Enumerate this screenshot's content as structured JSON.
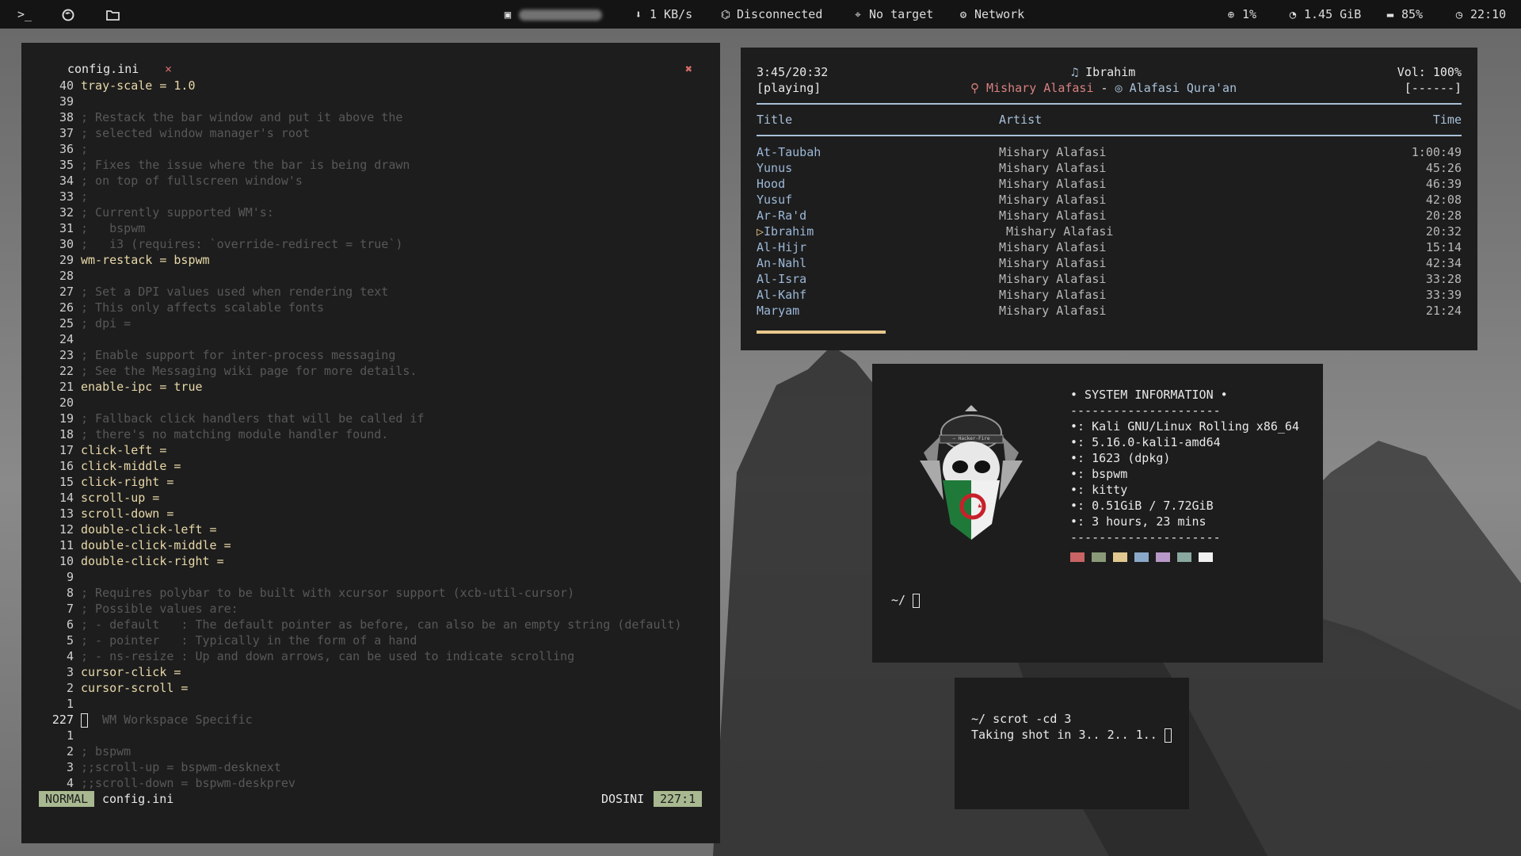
{
  "topbar": {
    "terminal_icon": "terminal-icon",
    "net_speed": "1 KB/s",
    "vpn": "Disconnected",
    "target": "No target",
    "network": "Network",
    "cpu": "1%",
    "ram": "1.45 GiB",
    "disk": "85%",
    "clock": "22:10"
  },
  "editor": {
    "tab_label": "config.ini",
    "tab_close": "×",
    "window_close": "✖",
    "lines": [
      {
        "n": "40",
        "text": "tray-scale = 1.0",
        "kind": "kw"
      },
      {
        "n": "39",
        "text": "",
        "kind": "cm"
      },
      {
        "n": "38",
        "text": "; Restack the bar window and put it above the",
        "kind": "cm"
      },
      {
        "n": "37",
        "text": "; selected window manager's root",
        "kind": "cm"
      },
      {
        "n": "36",
        "text": ";",
        "kind": "cm"
      },
      {
        "n": "35",
        "text": "; Fixes the issue where the bar is being drawn",
        "kind": "cm"
      },
      {
        "n": "34",
        "text": "; on top of fullscreen window's",
        "kind": "cm"
      },
      {
        "n": "33",
        "text": ";",
        "kind": "cm"
      },
      {
        "n": "32",
        "text": "; Currently supported WM's:",
        "kind": "cm"
      },
      {
        "n": "31",
        "text": ";   bspwm",
        "kind": "cm"
      },
      {
        "n": "30",
        "text": ";   i3 (requires: `override-redirect = true`)",
        "kind": "cm"
      },
      {
        "n": "29",
        "text": "wm-restack = bspwm",
        "kind": "kw"
      },
      {
        "n": "28",
        "text": "",
        "kind": "cm"
      },
      {
        "n": "27",
        "text": "; Set a DPI values used when rendering text",
        "kind": "cm"
      },
      {
        "n": "26",
        "text": "; This only affects scalable fonts",
        "kind": "cm"
      },
      {
        "n": "25",
        "text": "; dpi =",
        "kind": "cm"
      },
      {
        "n": "24",
        "text": "",
        "kind": "cm"
      },
      {
        "n": "23",
        "text": "; Enable support for inter-process messaging",
        "kind": "cm"
      },
      {
        "n": "22",
        "text": "; See the Messaging wiki page for more details.",
        "kind": "cm"
      },
      {
        "n": "21",
        "text": "enable-ipc = true",
        "kind": "kw"
      },
      {
        "n": "20",
        "text": "",
        "kind": "cm"
      },
      {
        "n": "19",
        "text": "; Fallback click handlers that will be called if",
        "kind": "cm"
      },
      {
        "n": "18",
        "text": "; there's no matching module handler found.",
        "kind": "cm"
      },
      {
        "n": "17",
        "text": "click-left =",
        "kind": "kw"
      },
      {
        "n": "16",
        "text": "click-middle =",
        "kind": "kw"
      },
      {
        "n": "15",
        "text": "click-right =",
        "kind": "kw"
      },
      {
        "n": "14",
        "text": "scroll-up =",
        "kind": "kw"
      },
      {
        "n": "13",
        "text": "scroll-down =",
        "kind": "kw"
      },
      {
        "n": "12",
        "text": "double-click-left =",
        "kind": "kw"
      },
      {
        "n": "11",
        "text": "double-click-middle =",
        "kind": "kw"
      },
      {
        "n": "10",
        "text": "double-click-right =",
        "kind": "kw"
      },
      {
        "n": "9",
        "text": "",
        "kind": "cm"
      },
      {
        "n": "8",
        "text": "; Requires polybar to be built with xcursor support (xcb-util-cursor)",
        "kind": "cm"
      },
      {
        "n": "7",
        "text": "; Possible values are:",
        "kind": "cm"
      },
      {
        "n": "6",
        "text": "; - default   : The default pointer as before, can also be an empty string (default)",
        "kind": "cm"
      },
      {
        "n": "5",
        "text": "; - pointer   : Typically in the form of a hand",
        "kind": "cm"
      },
      {
        "n": "4",
        "text": "; - ns-resize : Up and down arrows, can be used to indicate scrolling",
        "kind": "cm"
      },
      {
        "n": "3",
        "text": "cursor-click =",
        "kind": "kw"
      },
      {
        "n": "2",
        "text": "cursor-scroll =",
        "kind": "kw"
      },
      {
        "n": "1",
        "text": "",
        "kind": "cm"
      },
      {
        "n": "227",
        "text": "  WM Workspace Specific",
        "kind": "cur"
      },
      {
        "n": "1",
        "text": "",
        "kind": "cm"
      },
      {
        "n": "2",
        "text": "; bspwm",
        "kind": "cm"
      },
      {
        "n": "3",
        "text": ";;scroll-up = bspwm-desknext",
        "kind": "cm"
      },
      {
        "n": "4",
        "text": ";;scroll-down = bspwm-deskprev",
        "kind": "cm"
      }
    ],
    "status": {
      "mode": "NORMAL",
      "file": "config.ini",
      "filetype": "DOSINI",
      "position": "227:1"
    }
  },
  "music": {
    "elapsed": "3:45/20:32",
    "state": "[playing]",
    "song": "Ibrahim",
    "artist": "Mishary Alafasi",
    "separator": "-",
    "album": "Alafasi Qura'an",
    "volume": "Vol: 100%",
    "flags": "[------]",
    "headers": {
      "title": "Title",
      "artist": "Artist",
      "time": "Time"
    },
    "progress": 0.183,
    "accent": "#e8c88c",
    "tracks": [
      {
        "title": "At-Taubah",
        "artist": "Mishary Alafasi",
        "time": "1:00:49"
      },
      {
        "title": "Yunus",
        "artist": "Mishary Alafasi",
        "time": "45:26"
      },
      {
        "title": "Hood",
        "artist": "Mishary Alafasi",
        "time": "46:39"
      },
      {
        "title": "Yusuf",
        "artist": "Mishary Alafasi",
        "time": "42:08"
      },
      {
        "title": "Ar-Ra'd",
        "artist": "Mishary Alafasi",
        "time": "20:28"
      },
      {
        "title": "Ibrahim",
        "artist": "Mishary Alafasi",
        "time": "20:32",
        "playing": true
      },
      {
        "title": "Al-Hijr",
        "artist": "Mishary Alafasi",
        "time": "15:14"
      },
      {
        "title": "An-Nahl",
        "artist": "Mishary Alafasi",
        "time": "42:34"
      },
      {
        "title": "Al-Isra",
        "artist": "Mishary Alafasi",
        "time": "33:28"
      },
      {
        "title": "Al-Kahf",
        "artist": "Mishary Alafasi",
        "time": "33:39"
      },
      {
        "title": "Maryam",
        "artist": "Mishary Alafasi",
        "time": "21:24"
      }
    ]
  },
  "sysinfo": {
    "title": "• SYSTEM INFORMATION •",
    "divider": "---------------------",
    "lines": [
      "•: Kali GNU/Linux Rolling x86_64",
      "•: 5.16.0-kali1-amd64",
      "•: 1623 (dpkg)",
      "•: bspwm",
      "•: kitty",
      "•: 0.51GiB / 7.72GiB",
      "•: 3 hours, 23 mins"
    ],
    "logo_text": "— Hacker-Fire",
    "prompt": "~/",
    "swatches": [
      "#c86464",
      "#8a9a78",
      "#e0c890",
      "#8aa8c8",
      "#b898c8",
      "#88a8a0",
      "#f0f0f0"
    ]
  },
  "shot": {
    "prompt": "~/",
    "command": "scrot -cd 3",
    "output": "Taking shot in 3.. 2.. 1.."
  }
}
